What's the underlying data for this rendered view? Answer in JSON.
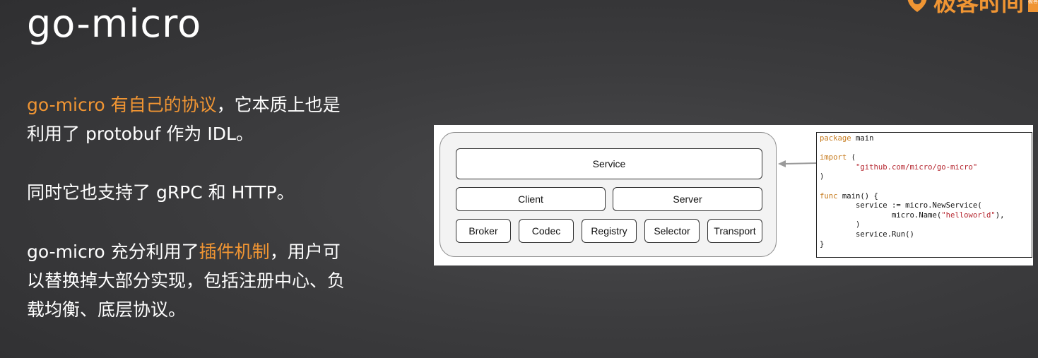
{
  "title": "go-micro",
  "logo": {
    "text": "极客时间",
    "tag": "极客"
  },
  "paragraphs": {
    "p1": {
      "highlight": "go-micro 有自己的协议",
      "line1_rest": "，它本质上也是",
      "line2": "利用了 protobuf 作为 IDL。"
    },
    "p2": {
      "text": "同时它也支持了 gRPC 和 HTTP。"
    },
    "p3": {
      "prefix": "go-micro 充分利用了",
      "highlight": "插件机制",
      "suffix": "，用户可",
      "line2": "以替换掉大部分实现，包括注册中心、负",
      "line3": "载均衡、底层协议。"
    }
  },
  "diagram": {
    "service": "Service",
    "client": "Client",
    "server": "Server",
    "plugins": [
      "Broker",
      "Codec",
      "Registry",
      "Selector",
      "Transport"
    ]
  },
  "code": {
    "kw_package": "package",
    "pkg_name": " main",
    "kw_import": "import",
    "import_open": " (",
    "import_path": "        \"github.com/micro/go-micro\"",
    "import_close": ")",
    "kw_func": "func",
    "func_sig": " main() {",
    "line_service": "        service := micro.NewService(",
    "line_name_pre": "                micro.Name(",
    "line_name_str": "\"helloworld\"",
    "line_name_post": "),",
    "line_close_paren": "        )",
    "line_run": "        service.Run()",
    "line_close_brace": "}"
  },
  "colors": {
    "accent": "#f09533",
    "background": "#3c3c3e"
  }
}
